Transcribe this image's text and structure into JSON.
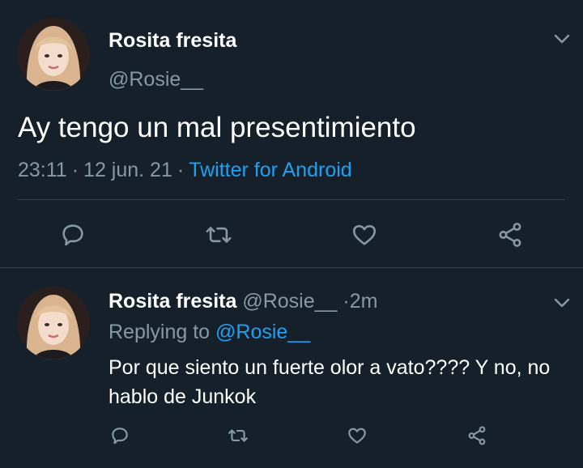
{
  "main_tweet": {
    "display_name": "Rosita fresita",
    "handle": "@Rosie__",
    "text": "Ay tengo un mal presentimiento",
    "time": "23:11",
    "separator": "·",
    "date": "12 jun. 21",
    "source": "Twitter for Android",
    "actions": [
      "reply-icon",
      "retweet-icon",
      "like-icon",
      "share-icon"
    ]
  },
  "reply_tweet": {
    "display_name": "Rosita fresita",
    "handle": "@Rosie__",
    "separator": "·",
    "age": "2m",
    "replying_prefix": "Replying to",
    "replying_to": "@Rosie__",
    "text": "Por que siento un fuerte olor a vato???? Y no, no hablo de Junkok",
    "actions": [
      "reply-icon",
      "retweet-icon",
      "like-icon",
      "share-icon"
    ]
  },
  "colors": {
    "background": "#15202b",
    "secondary_text": "#8899a6",
    "link": "#1da1f2",
    "divider": "#38444d"
  }
}
